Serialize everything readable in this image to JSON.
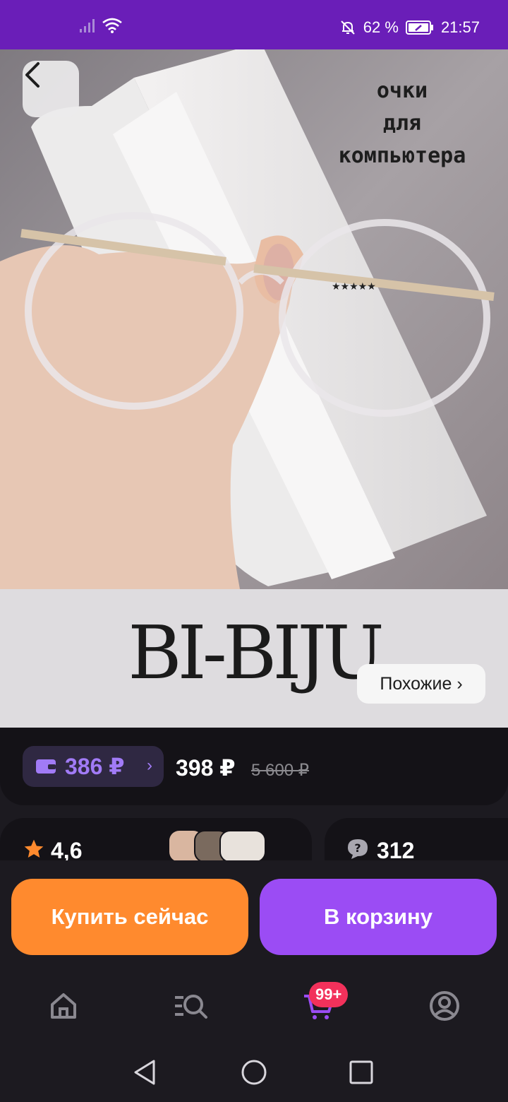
{
  "status_bar": {
    "battery": "62 %",
    "time": "21:57"
  },
  "product": {
    "image_caption_line1": "очки",
    "image_caption_line2": "для",
    "image_caption_line3": "компьютера",
    "brand": "BI-BIJU",
    "similar_label": "Похожие ›"
  },
  "price": {
    "wallet_price": "386 ₽",
    "current_price": "398 ₽",
    "old_price": "5 600 ₽"
  },
  "reviews": {
    "rating": "4,6",
    "questions_count": "312"
  },
  "actions": {
    "buy_now": "Купить сейчас",
    "add_to_cart": "В корзину"
  },
  "nav": {
    "cart_badge": "99+"
  },
  "colors": {
    "status_bar": "#6a1eb8",
    "wallet_accent": "#a17bf6",
    "buy_button": "#ff8a2e",
    "cart_button": "#9b4cf4",
    "badge": "#f2315b",
    "star": "#ff8a2e"
  }
}
